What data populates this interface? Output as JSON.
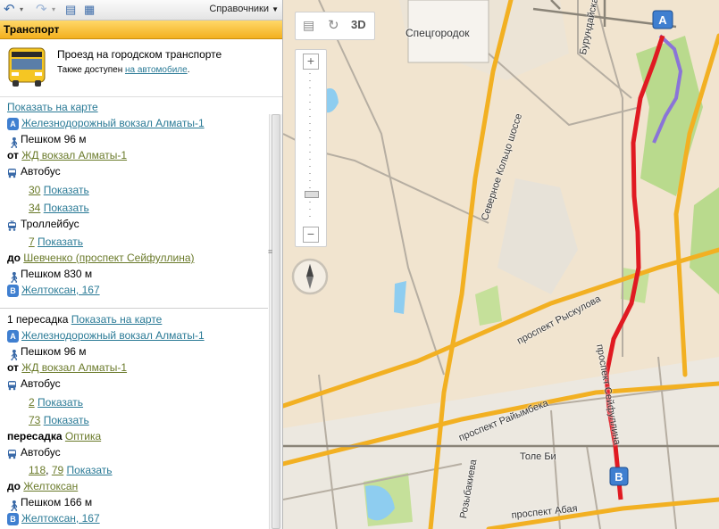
{
  "toolbar": {
    "back_icon": "undo-arrow-icon",
    "forward_icon": "redo-arrow-icon",
    "menu_label": "Справочники"
  },
  "header": {
    "title": "Транспорт"
  },
  "info": {
    "title": "Проезд на городском транспорте",
    "sub_prefix": "Также доступен",
    "sub_link": "на автомобиле",
    "sub_suffix": "."
  },
  "route1": {
    "show_on_map": "Показать на карте",
    "start": "Железнодорожный вокзал Алматы-1",
    "walk1": "Пешком 96 м",
    "from_label": "от",
    "from_stop": "ЖД вокзал Алматы-1",
    "bus_label": "Автобус",
    "bus_lines": [
      {
        "num": "30",
        "show": "Показать"
      },
      {
        "num": "34",
        "show": "Показать"
      }
    ],
    "trolley_label": "Троллейбус",
    "trolley_lines": [
      {
        "num": "7",
        "show": "Показать"
      }
    ],
    "to_label": "до",
    "to_stop": "Шевченко (проспект Сейфуллина)",
    "walk2": "Пешком 830 м",
    "end": "Желтоксан, 167"
  },
  "route2": {
    "transfers": "1 пересадка",
    "show_on_map": "Показать на карте",
    "start": "Железнодорожный вокзал Алматы-1",
    "walk1": "Пешком 96 м",
    "from_label": "от",
    "from_stop": "ЖД вокзал Алматы-1",
    "bus_label": "Автобус",
    "bus_lines": [
      {
        "num": "2",
        "show": "Показать"
      },
      {
        "num": "73",
        "show": "Показать"
      }
    ],
    "transfer_label": "пересадка",
    "transfer_stop": "Оптика",
    "bus2_label": "Автобус",
    "bus2_nums": "118",
    "bus2_nums_b": "79",
    "bus2_sep": ",",
    "bus2_show": "Показать",
    "to_label": "до",
    "to_stop": "Желтоксан",
    "walk2": "Пешком 166 м",
    "end": "Желтоксан, 167"
  },
  "map": {
    "btn_3d": "3D",
    "marker_a": "A",
    "marker_b": "B",
    "badge_a": "A",
    "badge_b": "B",
    "labels": {
      "spetsgorodok": "Спецгородок",
      "burundayskaya": "Бурундайская",
      "kolco": "Северное Кольцо шоссе",
      "ryskulova": "проспект Рыскулова",
      "raiymbeka": "проспект Райымбека",
      "tole_bi": "Толе Би",
      "rozybakieva": "Розыбакиева",
      "abaya": "проспект Абая",
      "seifullina": "проспект Сейфуллина"
    }
  },
  "colors": {
    "route_red": "#e01a22",
    "route_purple": "#8a74d8",
    "road_yellow": "#f2b022",
    "park_green": "#b7d98a",
    "water_blue": "#8ecdf0",
    "header_orange": "#f3b01e"
  }
}
